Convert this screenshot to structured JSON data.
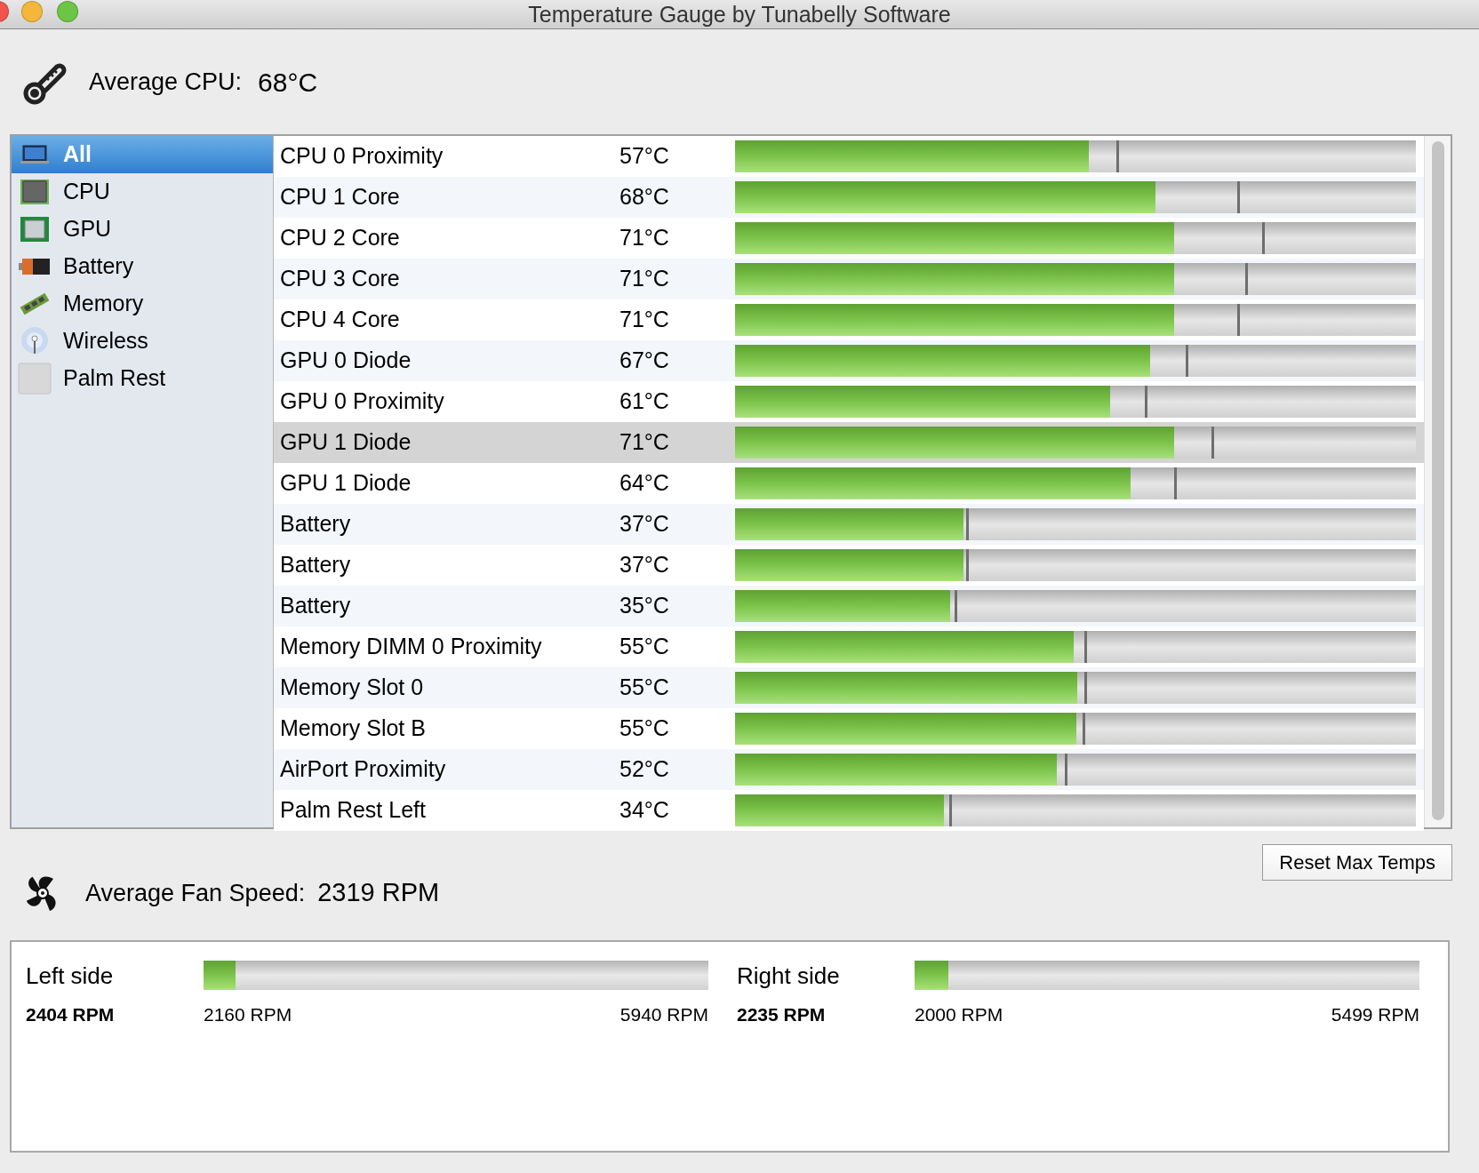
{
  "window": {
    "title": "Temperature Gauge by Tunabelly Software"
  },
  "average_cpu": {
    "label": "Average CPU:",
    "value": "68°C"
  },
  "sidebar": {
    "items": [
      {
        "kind": "all",
        "label": "All",
        "selected": true
      },
      {
        "kind": "cpu",
        "label": "CPU",
        "selected": false
      },
      {
        "kind": "gpu",
        "label": "GPU",
        "selected": false
      },
      {
        "kind": "battery",
        "label": "Battery",
        "selected": false
      },
      {
        "kind": "memory",
        "label": "Memory",
        "selected": false
      },
      {
        "kind": "wireless",
        "label": "Wireless",
        "selected": false
      },
      {
        "kind": "palm",
        "label": "Palm Rest",
        "selected": false
      }
    ]
  },
  "sensors": [
    {
      "name": "CPU 0 Proximity",
      "temp": "57°C",
      "level": 0.519,
      "max_marker": {
        "level": 0.56
      },
      "selected": false
    },
    {
      "name": "CPU 1 Core",
      "temp": "68°C",
      "level": 0.617,
      "max_marker": {
        "level": 0.738
      },
      "selected": false
    },
    {
      "name": "CPU 2 Core",
      "temp": "71°C",
      "level": 0.645,
      "max_marker": {
        "level": 0.774
      },
      "selected": false
    },
    {
      "name": "CPU 3 Core",
      "temp": "71°C",
      "level": 0.645,
      "max_marker": {
        "level": 0.749
      },
      "selected": false
    },
    {
      "name": "CPU 4 Core",
      "temp": "71°C",
      "level": 0.645,
      "max_marker": {
        "level": 0.738
      },
      "selected": false
    },
    {
      "name": "GPU 0 Diode",
      "temp": "67°C",
      "level": 0.61,
      "max_marker": {
        "level": 0.662
      },
      "selected": false
    },
    {
      "name": "GPU 0 Proximity",
      "temp": "61°C",
      "level": 0.551,
      "max_marker": {
        "level": 0.602
      },
      "selected": false
    },
    {
      "name": "GPU 1 Diode",
      "temp": "71°C",
      "level": 0.645,
      "max_marker": {
        "level": 0.7
      },
      "selected": true
    },
    {
      "name": "GPU 1 Diode",
      "temp": "64°C",
      "level": 0.581,
      "max_marker": {
        "level": 0.645
      },
      "selected": false
    },
    {
      "name": "Battery",
      "temp": "37°C",
      "level": 0.336,
      "max_marker": {
        "level": 0.34
      },
      "selected": false
    },
    {
      "name": "Battery",
      "temp": "37°C",
      "level": 0.336,
      "max_marker": {
        "level": 0.34
      },
      "selected": false
    },
    {
      "name": "Battery",
      "temp": "35°C",
      "level": 0.316,
      "max_marker": {
        "level": 0.322
      },
      "selected": false
    },
    {
      "name": "Memory DIMM 0 Proximity",
      "temp": "55°C",
      "level": 0.497,
      "max_marker": {
        "level": 0.513
      },
      "selected": false
    },
    {
      "name": "Memory Slot 0",
      "temp": "55°C",
      "level": 0.503,
      "max_marker": {
        "level": 0.513
      },
      "selected": false
    },
    {
      "name": "Memory Slot B",
      "temp": "55°C",
      "level": 0.501,
      "max_marker": {
        "level": 0.51
      },
      "selected": false
    },
    {
      "name": "AirPort Proximity",
      "temp": "52°C",
      "level": 0.473,
      "max_marker": {
        "level": 0.484
      },
      "selected": false
    },
    {
      "name": "Palm Rest Left",
      "temp": "34°C",
      "level": 0.307,
      "max_marker": {
        "level": 0.314
      },
      "selected": false
    }
  ],
  "reset_button": {
    "label": "Reset Max Temps"
  },
  "average_fan": {
    "label": "Average Fan Speed:",
    "value": "2319 RPM"
  },
  "fans": [
    {
      "name": "Left side",
      "speed": "2404 RPM",
      "min": "2160 RPM",
      "max": "5940 RPM",
      "level": 0.064
    },
    {
      "name": "Right side",
      "speed": "2235 RPM",
      "min": "2000 RPM",
      "max": "5499 RPM",
      "level": 0.067
    }
  ]
}
